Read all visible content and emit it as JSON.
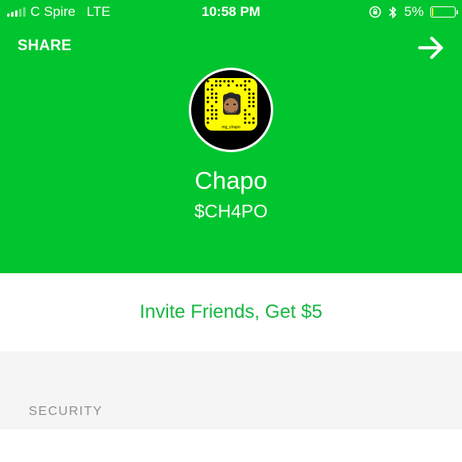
{
  "status_bar": {
    "carrier": "C Spire",
    "network": "LTE",
    "time": "10:58 PM",
    "battery": "5%",
    "battery_level": 0.05,
    "icons": [
      "signal-bars-icon",
      "rotation-lock-icon",
      "bluetooth-icon",
      "battery-icon"
    ]
  },
  "header": {
    "share_label": "SHARE",
    "forward_icon": "arrow-right-icon",
    "snapcode_username": "mg_chapo",
    "display_name": "Chapo",
    "cashtag": "$CH4PO"
  },
  "invite": {
    "label": "Invite Friends, Get $5"
  },
  "sections": {
    "security_label": "SECURITY"
  },
  "colors": {
    "brand_green": "#00c52f",
    "invite_text": "#15b740",
    "snapcode_yellow": "#fffc00",
    "section_bg": "#f5f5f5",
    "section_label": "#8f8f8f"
  }
}
